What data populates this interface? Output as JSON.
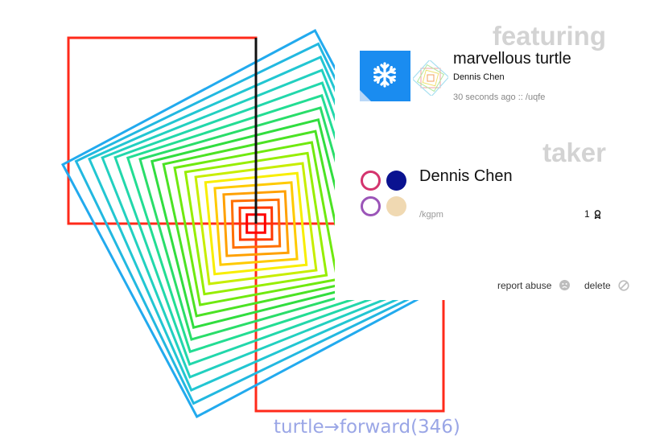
{
  "canvas": {
    "code_caption": "turtle→forward(346)",
    "art_colors": [
      "#ff0000",
      "#ff8800",
      "#ffee00",
      "#88ee00",
      "#33dd33",
      "#22dd99",
      "#22cccc",
      "#22aaee"
    ]
  },
  "featuring": {
    "heading": "featuring",
    "tile_color": "#1a8cf0",
    "tile_icon": "snowflake-icon",
    "title": "marvellous turtle",
    "author": "Dennis Chen",
    "meta": "30 seconds ago :: /uqfe"
  },
  "taker": {
    "heading": "taker",
    "name": "Dennis Chen",
    "code": "/kgpm",
    "count": "1",
    "count_icon": "award-ribbon-icon",
    "dot_colors": [
      "#d4346e",
      "#0a1290",
      "#9b55b8",
      "#f0d9b2"
    ]
  },
  "actions": {
    "report_label": "report abuse",
    "report_icon": "sad-face-icon",
    "delete_label": "delete",
    "delete_icon": "no-entry-icon"
  }
}
